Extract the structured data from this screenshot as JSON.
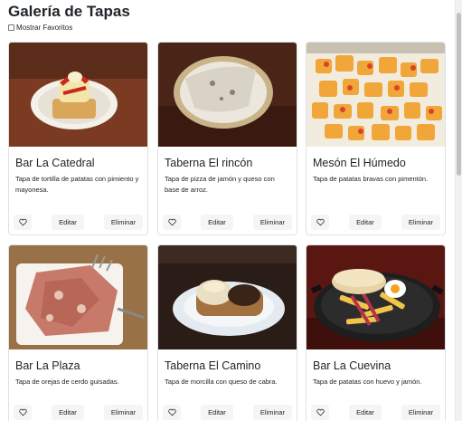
{
  "page": {
    "title": "Galería de Tapas",
    "show_favorites_label": "Mostrar Favoritos"
  },
  "cards": [
    {
      "name": "Bar La Catedral",
      "description": "Tapa de tortilla de patatas con pimiento y mayonesa.",
      "edit_label": "Editar",
      "delete_label": "Eliminar",
      "image": "tortilla-icon"
    },
    {
      "name": "Taberna El rincón",
      "description": "Tapa de pizza de jamón y queso con base de arroz.",
      "edit_label": "Editar",
      "delete_label": "Eliminar",
      "image": "pizza-icon"
    },
    {
      "name": "Mesón El Húmedo",
      "description": "Tapa de patatas bravas con pimentón.",
      "edit_label": "Editar",
      "delete_label": "Eliminar",
      "image": "bravas-icon"
    },
    {
      "name": "Bar La Plaza",
      "description": "Tapa de orejas de cerdo guisadas.",
      "edit_label": "Editar",
      "delete_label": "Eliminar",
      "image": "orejas-icon"
    },
    {
      "name": "Taberna El Camino",
      "description": "Tapa de morcilla con queso de cabra.",
      "edit_label": "Editar",
      "delete_label": "Eliminar",
      "image": "morcilla-icon"
    },
    {
      "name": "Bar La Cuevina",
      "description": "Tapa de patatas con huevo y jamón.",
      "edit_label": "Editar",
      "delete_label": "Eliminar",
      "image": "huevo-icon"
    }
  ]
}
